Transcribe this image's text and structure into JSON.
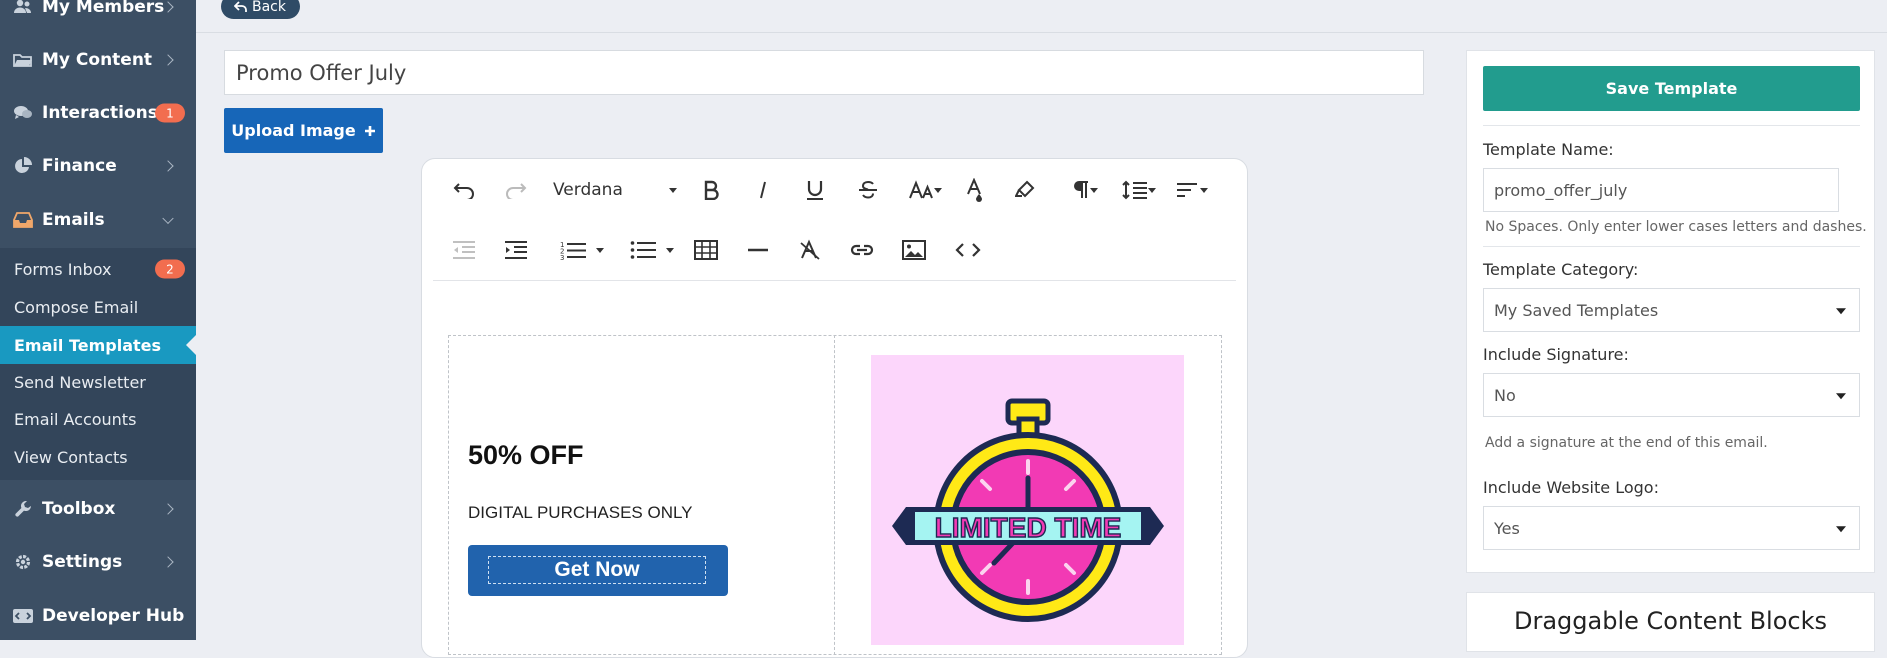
{
  "sidebar": {
    "items": [
      {
        "label": "My Members",
        "icon": "members-icon"
      },
      {
        "label": "My Content",
        "icon": "folder-icon"
      },
      {
        "label": "Interactions",
        "icon": "chat-icon",
        "badge": "1"
      },
      {
        "label": "Finance",
        "icon": "pie-chart-icon"
      },
      {
        "label": "Emails",
        "icon": "inbox-icon"
      },
      {
        "label": "Toolbox",
        "icon": "wrench-icon"
      },
      {
        "label": "Settings",
        "icon": "gear-icon"
      },
      {
        "label": "Developer Hub",
        "icon": "code-icon"
      }
    ],
    "email_subitems": [
      {
        "label": "Forms Inbox",
        "badge": "2"
      },
      {
        "label": "Compose Email"
      },
      {
        "label": "Email Templates",
        "active": true
      },
      {
        "label": "Send Newsletter"
      },
      {
        "label": "Email Accounts"
      },
      {
        "label": "View Contacts"
      }
    ],
    "colors": {
      "background": "#3c4f64",
      "active": "#1999c1",
      "badge": "#f26d4f"
    }
  },
  "header": {
    "back_label": "Back"
  },
  "editor": {
    "title_value": "Promo Offer July",
    "upload_label": "Upload Image",
    "font_name": "Verdana",
    "content": {
      "headline": "50% OFF",
      "subtext": "DIGITAL PURCHASES ONLY",
      "button_label": "Get Now",
      "image_text": "LIMITED TIME"
    }
  },
  "panel": {
    "save_label": "Save Template",
    "template_name_label": "Template Name:",
    "template_name_value": "promo_offer_july",
    "template_name_help": "No Spaces. Only enter lower cases letters and dashes.",
    "category_label": "Template Category:",
    "category_value": "My Saved Templates",
    "signature_label": "Include Signature:",
    "signature_value": "No",
    "signature_help": "Add a signature at the end of this email.",
    "logo_label": "Include Website Logo:",
    "logo_value": "Yes",
    "blocks_title": "Draggable Content Blocks",
    "colors": {
      "save": "#229c8e",
      "upload": "#1766b8"
    }
  }
}
